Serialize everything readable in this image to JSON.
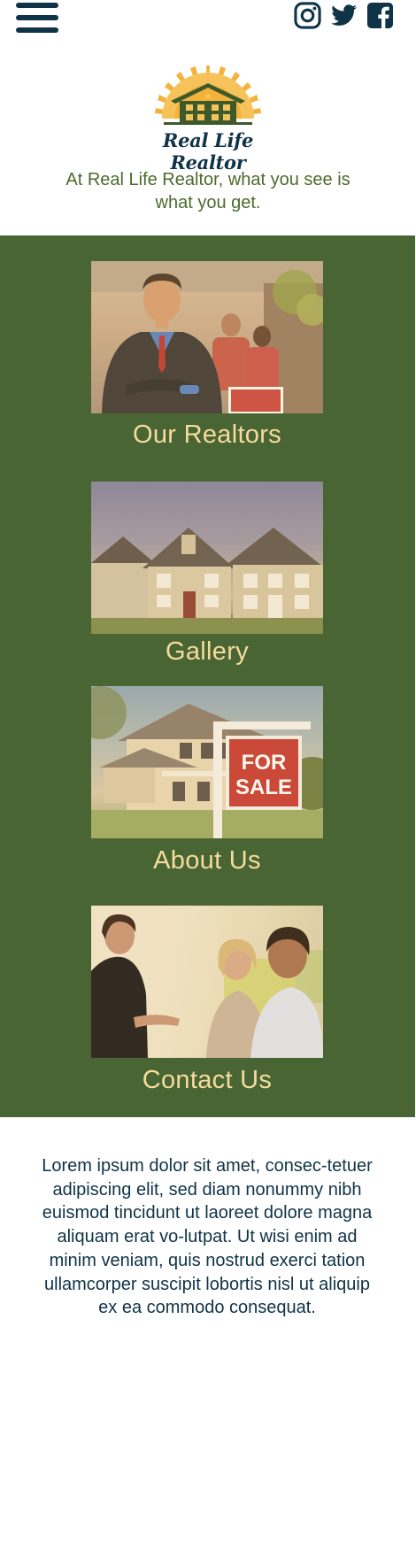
{
  "header": {
    "menu_icon": "hamburger-menu-icon",
    "social": [
      {
        "name": "instagram",
        "icon": "instagram-icon"
      },
      {
        "name": "twitter",
        "icon": "twitter-icon"
      },
      {
        "name": "facebook",
        "icon": "facebook-icon"
      }
    ]
  },
  "brand": {
    "name": "Real Life Realtor",
    "tagline": "At Real Life Realtor, what you see is what you get."
  },
  "nav": {
    "items": [
      {
        "label": "Our Realtors",
        "photo": "realtor-photo"
      },
      {
        "label": "Gallery",
        "photo": "houses-photo"
      },
      {
        "label": "About Us",
        "photo": "for-sale-house-photo"
      },
      {
        "label": "Contact Us",
        "photo": "meeting-photo"
      }
    ]
  },
  "main": {
    "body_text": "Lorem ipsum dolor sit amet, consec-tetuer adipiscing elit, sed diam nonummy nibh euismod tincidunt ut laoreet dolore magna aliquam erat vo-lutpat. Ut wisi enim ad minim veniam, quis nostrud exerci tation ullamcorper suscipit lobortis nisl ut aliquip ex ea commodo consequat."
  },
  "colors": {
    "navy": "#0f3347",
    "green_section": "#4a6534",
    "label_cream": "#f5dc9c",
    "tagline_green": "#4c6a2d",
    "sun_orange": "#f4b23b"
  }
}
